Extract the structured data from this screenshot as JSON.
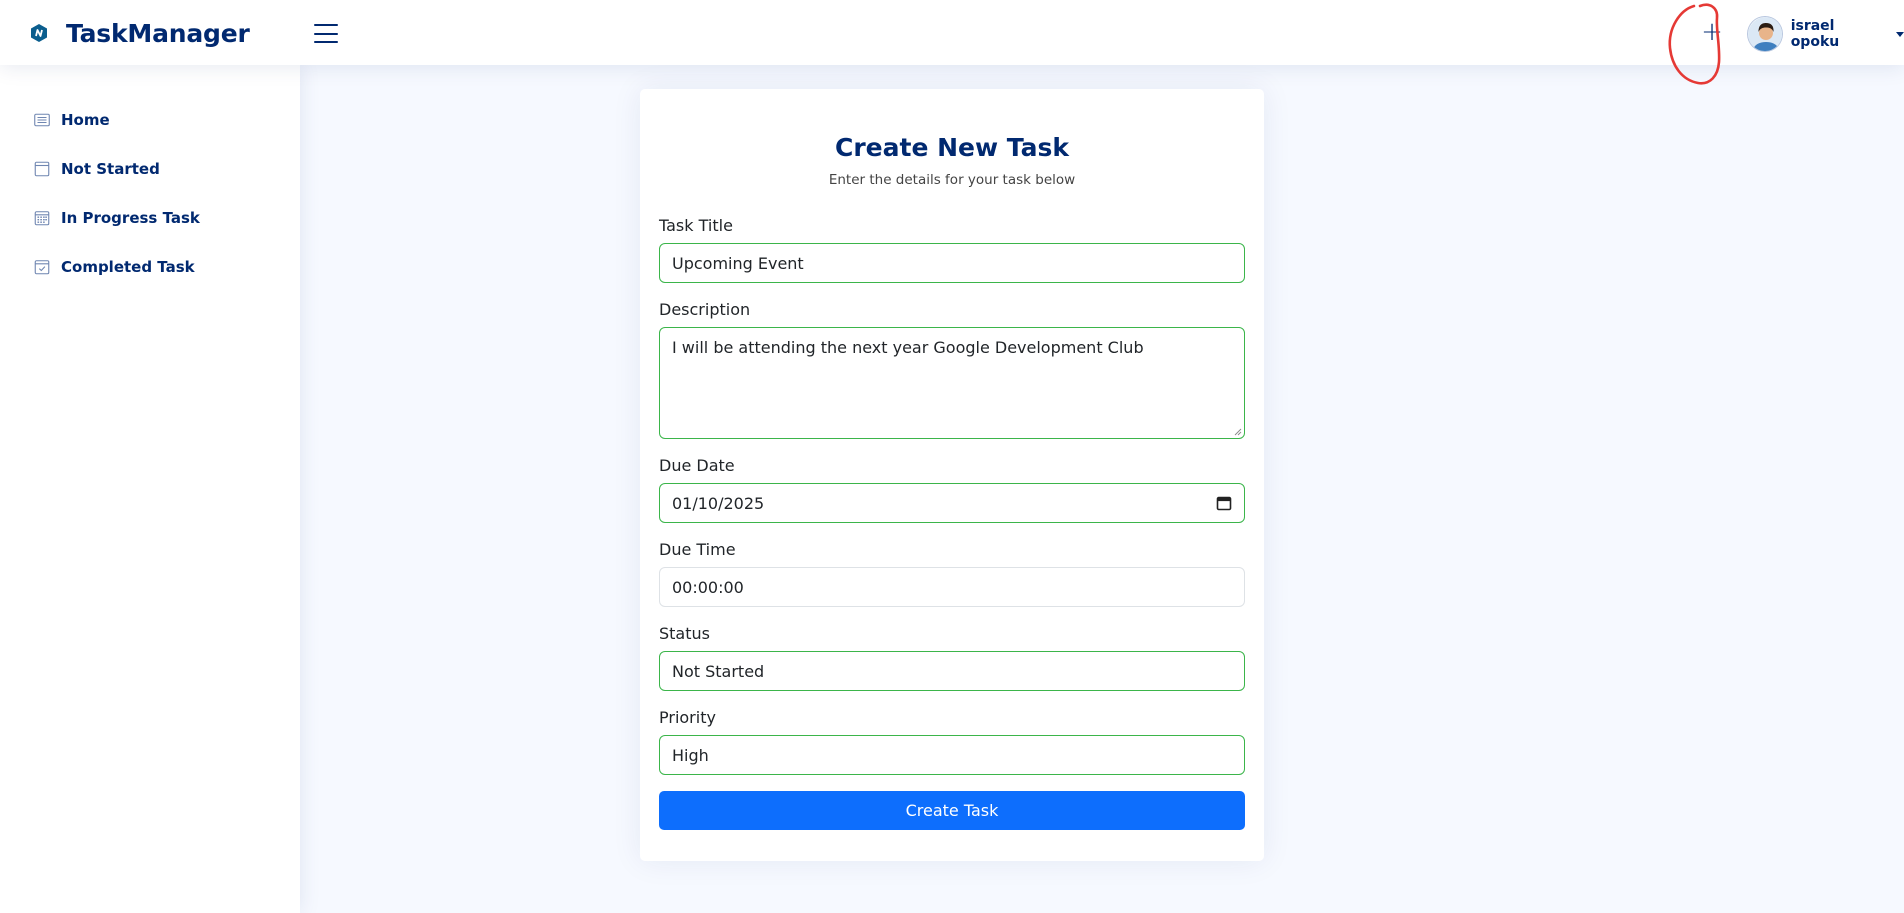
{
  "header": {
    "logo_text": "TaskManager",
    "user_name": "israel opoku",
    "add_glyph": "+"
  },
  "sidebar": {
    "items": [
      {
        "label": "Home",
        "icon": "list-icon"
      },
      {
        "label": "Not Started",
        "icon": "window-icon"
      },
      {
        "label": "In Progress Task",
        "icon": "calendar-grid-icon"
      },
      {
        "label": "Completed Task",
        "icon": "calendar-check-icon"
      }
    ]
  },
  "form": {
    "title": "Create New Task",
    "subtitle": "Enter the details for your task below",
    "fields": {
      "task_title": {
        "label": "Task Title",
        "value": "Upcoming Event"
      },
      "description": {
        "label": "Description",
        "value": "I will be attending the next year Google Development Club"
      },
      "due_date": {
        "label": "Due Date",
        "value": "01/10/2025"
      },
      "due_time": {
        "label": "Due Time",
        "value": "00:00:00"
      },
      "status": {
        "label": "Status",
        "value": "Not Started"
      },
      "priority": {
        "label": "Priority",
        "value": "High"
      }
    },
    "submit_label": "Create Task"
  },
  "colors": {
    "brand": "#012970",
    "valid_border": "#3bb54a",
    "primary_button": "#0d6efd",
    "annotation": "#e53935",
    "page_background": "#f6f9ff"
  }
}
